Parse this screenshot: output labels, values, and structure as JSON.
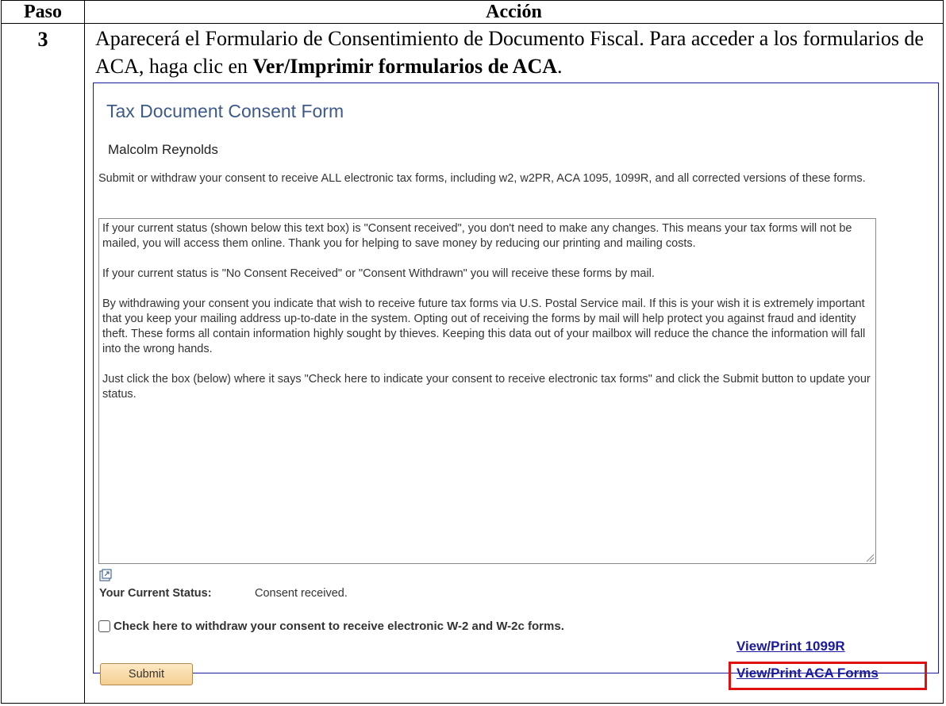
{
  "table": {
    "col_paso": "Paso",
    "col_accion": "Acción",
    "step": "3",
    "instruction_part1": "Aparecerá el Formulario de Consentimiento de Documento Fiscal.  Para acceder a los formularios de ACA, haga clic en ",
    "instruction_bold": "Ver/Imprimir formularios de ACA",
    "instruction_end": "."
  },
  "form": {
    "title": "Tax Document Consent Form",
    "employee_name": "Malcolm Reynolds",
    "description": "Submit or withdraw your consent to receive ALL electronic tax forms, including w2, w2PR, ACA 1095, 1099R, and all corrected versions of these forms.",
    "textarea_paragraphs": [
      "If your current status (shown below this text box) is \"Consent received\", you don't need to make any changes. This means your tax forms will not be mailed, you will access them online. Thank you for helping to save money by reducing our printing and mailing costs.",
      "If your current status is \"No Consent Received\" or  \"Consent Withdrawn\" you will  receive these forms by mail.",
      "By withdrawing your consent you indicate that wish to receive future tax forms via U.S. Postal Service mail. If this is your wish it is extremely important that you keep your mailing address up-to-date in the system. Opting out of receiving the forms by mail will help protect you against fraud and identity theft. These forms all contain information highly sought by thieves. Keeping this data out of your mailbox will reduce the chance the information will fall into the wrong hands.",
      "Just click the box (below) where it says \"Check here to indicate your consent to receive electronic tax forms\" and click the Submit button to update your status."
    ],
    "status_label": "Your Current Status:",
    "status_value": "Consent received.",
    "withdraw_checkbox_label": "Check here to withdraw your consent to receive electronic W-2 and W-2c forms.",
    "withdraw_checked": false,
    "link_1099r": "View/Print 1099R",
    "link_aca": "View/Print ACA Forms",
    "submit_label": "Submit",
    "highlight_color": "#e01010",
    "link_color": "#1a1aa0"
  }
}
